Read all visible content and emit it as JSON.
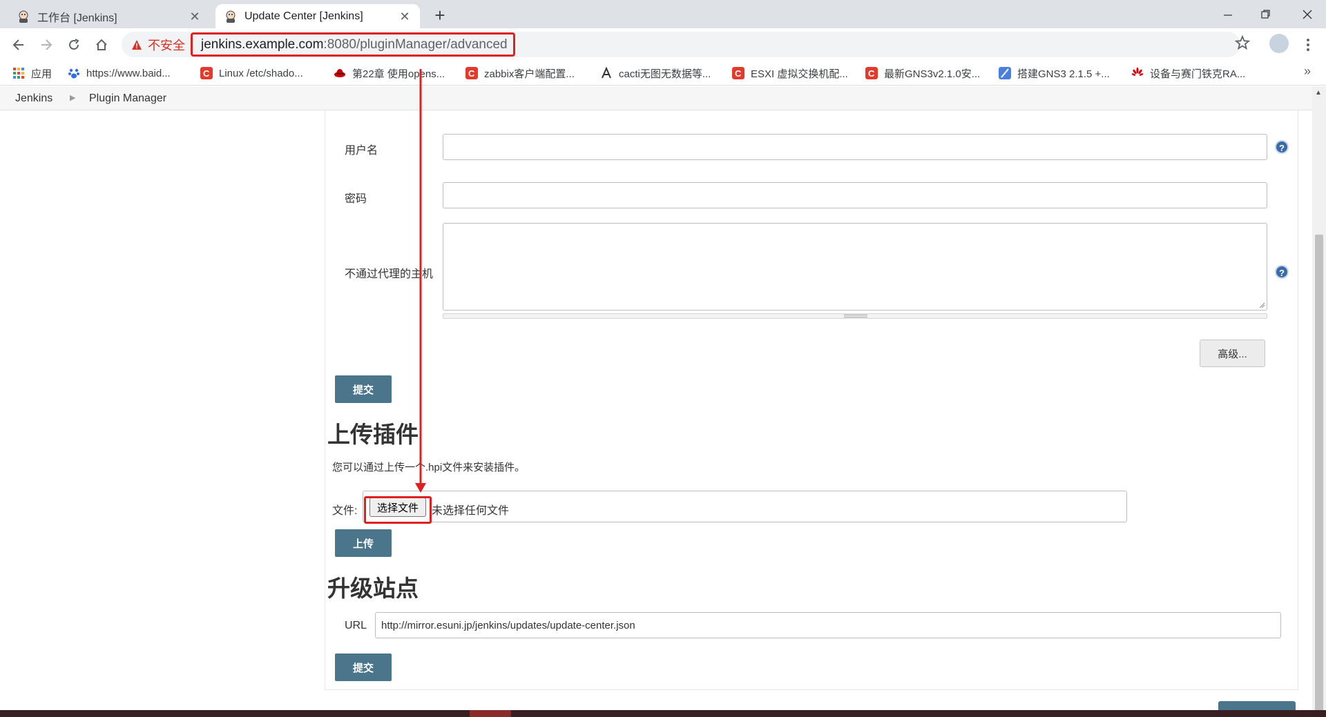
{
  "browser": {
    "tabs": [
      {
        "title": "工作台 [Jenkins]",
        "active": false
      },
      {
        "title": "Update Center [Jenkins]",
        "active": true
      }
    ],
    "security_label": "不安全",
    "url_host": "jenkins.example.com",
    "url_path": ":8080/pluginManager/advanced",
    "bookmarks": [
      {
        "label": "应用",
        "icon": "apps-grid-icon"
      },
      {
        "label": "https://www.baid...",
        "icon": "baidu-paw-icon"
      },
      {
        "label": "Linux /etc/shado...",
        "icon": "csdn-c-icon"
      },
      {
        "label": "第22章 使用opens...",
        "icon": "redhat-icon"
      },
      {
        "label": "zabbix客户端配置...",
        "icon": "csdn-c-icon"
      },
      {
        "label": "cacti无图无数据等...",
        "icon": "cacti-icon"
      },
      {
        "label": "ESXI 虚拟交换机配...",
        "icon": "csdn-c-icon"
      },
      {
        "label": "最新GNS3v2.1.0安...",
        "icon": "csdn-c-icon"
      },
      {
        "label": "搭建GNS3 2.1.5 +...",
        "icon": "feather-icon"
      },
      {
        "label": "设备与赛门铁克RA...",
        "icon": "huawei-icon"
      }
    ],
    "bookmarks_more": "»"
  },
  "breadcrumb": {
    "items": [
      "Jenkins",
      "Plugin Manager"
    ]
  },
  "proxy": {
    "username_label": "用户名",
    "password_label": "密码",
    "no_proxy_label": "不通过代理的主机",
    "advanced_button": "高级...",
    "submit_button": "提交"
  },
  "upload": {
    "heading": "上传插件",
    "description": "您可以通过上传一个.hpi文件来安装插件。",
    "file_label": "文件:",
    "choose_button": "选择文件",
    "no_file_text": "未选择任何文件",
    "upload_button": "上传"
  },
  "update_site": {
    "heading": "升级站点",
    "url_label": "URL",
    "url_value": "http://mirror.esuni.jp/jenkins/updates/update-center.json",
    "submit_button": "提交"
  },
  "colors": {
    "jenkins_button": "#4b758b",
    "annotation_red": "#e02020",
    "help_icon": "#3b6aa8"
  }
}
